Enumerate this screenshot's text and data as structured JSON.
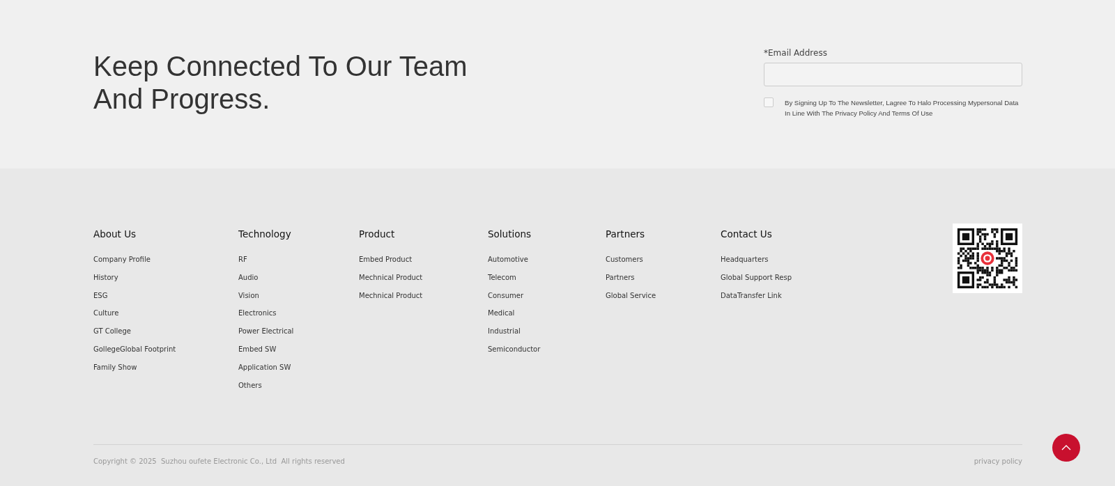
{
  "newsletter": {
    "heading": "Keep Connected To Our Team And Progress.",
    "email_label": "*Email Address",
    "consent": {
      "checked": false,
      "text": "By Signing Up To The Newsletter, Lagree To Halo Processing Mypersonal Data In Line With The Privacy Policy And Terms Of Use"
    }
  },
  "footer": {
    "columns": [
      {
        "title": "About Us",
        "links": [
          "Company Profile",
          "History",
          "ESG",
          "Culture",
          "GT College",
          "GollegeGlobal Footprint",
          "Family Show"
        ]
      },
      {
        "title": "Technology",
        "links": [
          "RF",
          "Audio",
          "Vision",
          "Electronics",
          "Power Electrical",
          "Embed SW",
          "Application SW",
          "Others"
        ]
      },
      {
        "title": "Product",
        "links": [
          "Embed Product",
          "Mechnical Product",
          "Mechnical Product"
        ]
      },
      {
        "title": "Solutions",
        "links": [
          "Automotive",
          "Telecom",
          "Consumer",
          "Medical",
          "Industrial",
          "Semiconductor"
        ]
      },
      {
        "title": "Partners",
        "links": [
          "Customers",
          "Partners",
          "Global Service"
        ]
      },
      {
        "title": "Contact Us",
        "links": [
          "Headquarters",
          "Global Support Resp",
          "DataTransfer Link"
        ]
      }
    ],
    "copyright": "Copyright © 2025  Suzhou oufete Electronic Co., Ltd  All rights reserved",
    "privacy_link": "privacy policy"
  }
}
